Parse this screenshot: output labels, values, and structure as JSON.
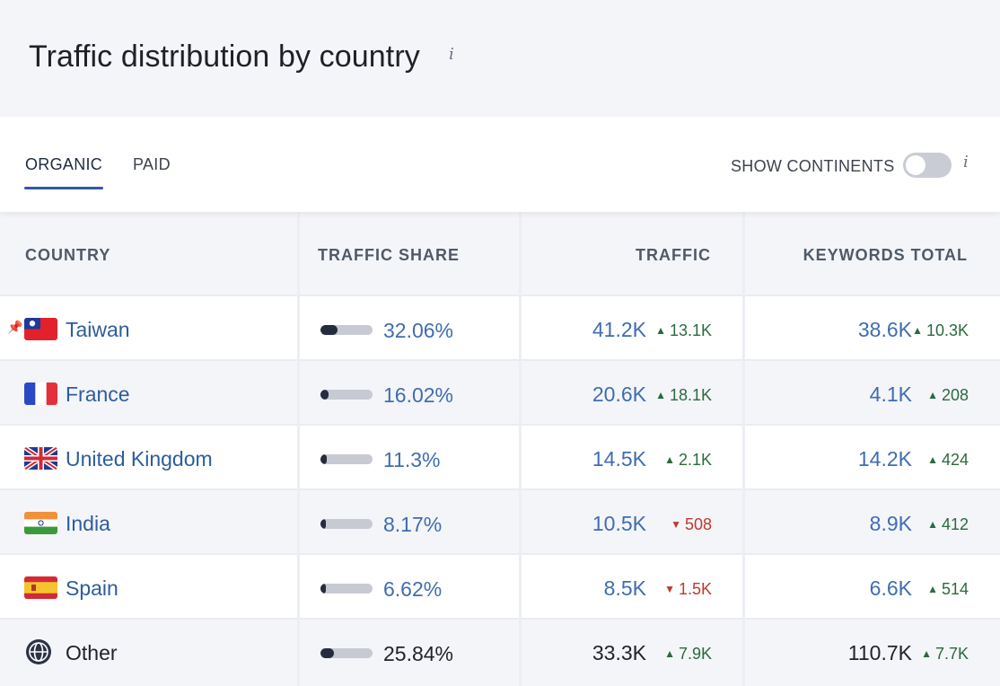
{
  "header": {
    "title": "Traffic distribution by country",
    "info_icon": "i"
  },
  "tabs": [
    {
      "label": "ORGANIC",
      "active": true
    },
    {
      "label": "PAID",
      "active": false
    }
  ],
  "show_continents": {
    "label": "SHOW CONTINENTS",
    "enabled": false,
    "info_icon": "i"
  },
  "columns": {
    "country": "COUNTRY",
    "traffic_share": "TRAFFIC SHARE",
    "traffic": "TRAFFIC",
    "keywords_total": "KEYWORDS TOTAL"
  },
  "colors": {
    "accent": "#3f6db0",
    "up": "#2b6a3e",
    "down": "#c0392b",
    "bar": "#262c3f"
  },
  "rows": [
    {
      "country": "Taiwan",
      "flag": "taiwan-flag-icon",
      "pinned": true,
      "share": "32.06%",
      "share_value": 0.3206,
      "traffic": "41.2K",
      "traffic_delta": "13.1K",
      "traffic_dir": "up",
      "keywords": "38.6K",
      "keywords_delta": "10.3K",
      "keywords_dir": "up"
    },
    {
      "country": "France",
      "flag": "france-flag-icon",
      "pinned": false,
      "share": "16.02%",
      "share_value": 0.1602,
      "traffic": "20.6K",
      "traffic_delta": "18.1K",
      "traffic_dir": "up",
      "keywords": "4.1K",
      "keywords_delta": "208",
      "keywords_dir": "up"
    },
    {
      "country": "United Kingdom",
      "flag": "uk-flag-icon",
      "pinned": false,
      "share": "11.3%",
      "share_value": 0.113,
      "traffic": "14.5K",
      "traffic_delta": "2.1K",
      "traffic_dir": "up",
      "keywords": "14.2K",
      "keywords_delta": "424",
      "keywords_dir": "up"
    },
    {
      "country": "India",
      "flag": "india-flag-icon",
      "pinned": false,
      "share": "8.17%",
      "share_value": 0.0817,
      "traffic": "10.5K",
      "traffic_delta": "508",
      "traffic_dir": "down",
      "keywords": "8.9K",
      "keywords_delta": "412",
      "keywords_dir": "up"
    },
    {
      "country": "Spain",
      "flag": "spain-flag-icon",
      "pinned": false,
      "share": "6.62%",
      "share_value": 0.0662,
      "traffic": "8.5K",
      "traffic_delta": "1.5K",
      "traffic_dir": "down",
      "keywords": "6.6K",
      "keywords_delta": "514",
      "keywords_dir": "up"
    },
    {
      "country": "Other",
      "flag": "globe-icon",
      "pinned": false,
      "share": "25.84%",
      "share_value": 0.2584,
      "traffic": "33.3K",
      "traffic_delta": "7.9K",
      "traffic_dir": "up",
      "keywords": "110.7K",
      "keywords_delta": "7.7K",
      "keywords_dir": "up"
    }
  ]
}
